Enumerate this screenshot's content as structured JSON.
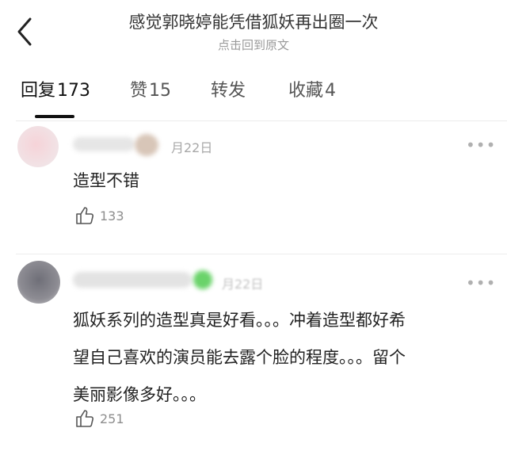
{
  "header": {
    "title": "感觉郭晓婷能凭借狐妖再出圈一次",
    "subtitle": "点击回到原文"
  },
  "tabs": [
    {
      "label": "回复",
      "count": "173",
      "active": true
    },
    {
      "label": "赞",
      "count": "15",
      "active": false
    },
    {
      "label": "转发",
      "count": "",
      "active": false
    },
    {
      "label": "收藏",
      "count": "4",
      "active": false
    }
  ],
  "comments": [
    {
      "date": "月22日",
      "lines": [
        "造型不错"
      ],
      "likes": "133"
    },
    {
      "date": "月22日",
      "lines": [
        "狐妖系列的造型真是好看。。。冲着造型都好希",
        "望自己喜欢的演员能去露个脸的程度。。。留个",
        "美丽影像多好。。。"
      ],
      "likes": "251"
    }
  ],
  "icons": {
    "back": "chevron-left-icon",
    "more": "more-dots-icon",
    "like": "thumbs-up-icon"
  },
  "colors": {
    "accent_underline": "#111111",
    "muted_text": "#9a9a9a",
    "verified_badge": "#6ad36a"
  }
}
